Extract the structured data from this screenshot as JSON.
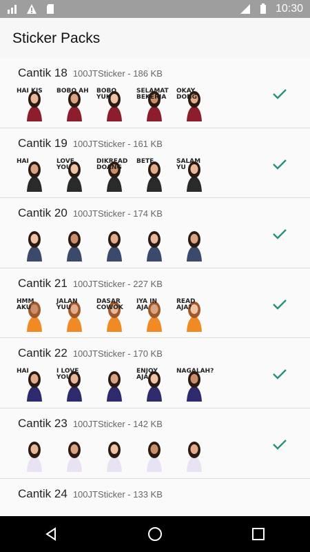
{
  "status_bar": {
    "time": "10:30",
    "icons": [
      "data-icon",
      "alert-icon",
      "sd-card-icon",
      "signal-icon",
      "battery-icon"
    ]
  },
  "title": "Sticker Packs",
  "colors": {
    "accent_check": "#2a8f7a",
    "background": "#fafafa",
    "status_bar": "#9e9e9e",
    "nav_bar": "#000000"
  },
  "packs": [
    {
      "name": "Cantik 18",
      "publisher": "100JTSticker",
      "size": "186 KB",
      "added": true,
      "stickers": [
        "HAI KIS",
        "BOBO AH",
        "BOBO YUK",
        "SELAMAT BEKERJA",
        "OKAY DONG"
      ]
    },
    {
      "name": "Cantik 19",
      "publisher": "100JTSticker",
      "size": "161 KB",
      "added": true,
      "stickers": [
        "HAI",
        "LOVE YOU",
        "DIKREAD DOANG",
        "BETE",
        "SALAM YU"
      ]
    },
    {
      "name": "Cantik 20",
      "publisher": "100JTSticker",
      "size": "174 KB",
      "added": true,
      "stickers": [
        "",
        "",
        "",
        "",
        ""
      ]
    },
    {
      "name": "Cantik 21",
      "publisher": "100JTSticker",
      "size": "227 KB",
      "added": true,
      "stickers": [
        "HMM AKU",
        "JALAN YUU",
        "DASAR COWOK",
        "IYA IN AJA",
        "READ AJA?"
      ]
    },
    {
      "name": "Cantik 22",
      "publisher": "100JTSticker",
      "size": "170 KB",
      "added": true,
      "stickers": [
        "HAI",
        "I LOVE YOU",
        "",
        "ENJOY AJA",
        "NAGALAH?"
      ]
    },
    {
      "name": "Cantik 23",
      "publisher": "100JTSticker",
      "size": "142 KB",
      "added": true,
      "stickers": [
        "",
        "",
        "",
        "",
        ""
      ]
    },
    {
      "name": "Cantik 24",
      "publisher": "100JTSticker",
      "size": "133 KB",
      "added": false,
      "stickers": []
    }
  ],
  "nav": [
    "back-icon",
    "home-icon",
    "recents-icon"
  ]
}
